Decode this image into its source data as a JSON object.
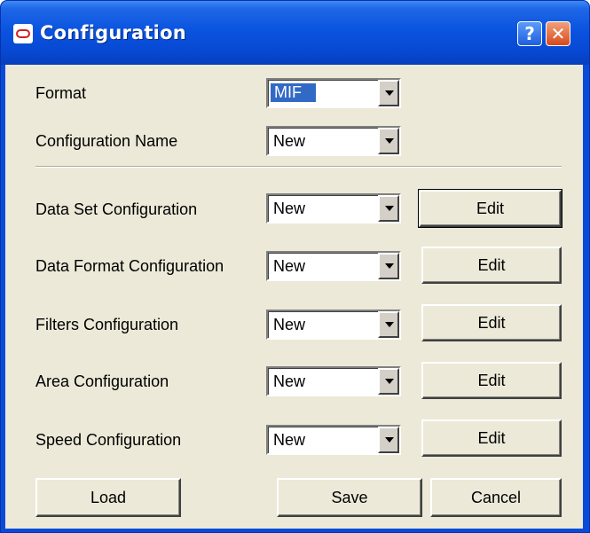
{
  "window": {
    "title": "Configuration",
    "help_glyph": "?",
    "close_glyph": "✕"
  },
  "form": {
    "format": {
      "label": "Format",
      "value": "MIF"
    },
    "config_name": {
      "label": "Configuration Name",
      "value": "New"
    },
    "rows": [
      {
        "label": "Data Set Configuration",
        "value": "New",
        "button": "Edit"
      },
      {
        "label": "Data Format Configuration",
        "value": "New",
        "button": "Edit"
      },
      {
        "label": "Filters Configuration",
        "value": "New",
        "button": "Edit"
      },
      {
        "label": "Area Configuration",
        "value": "New",
        "button": "Edit"
      },
      {
        "label": "Speed Configuration",
        "value": "New",
        "button": "Edit"
      }
    ]
  },
  "footer": {
    "load": "Load",
    "save": "Save",
    "cancel": "Cancel"
  }
}
